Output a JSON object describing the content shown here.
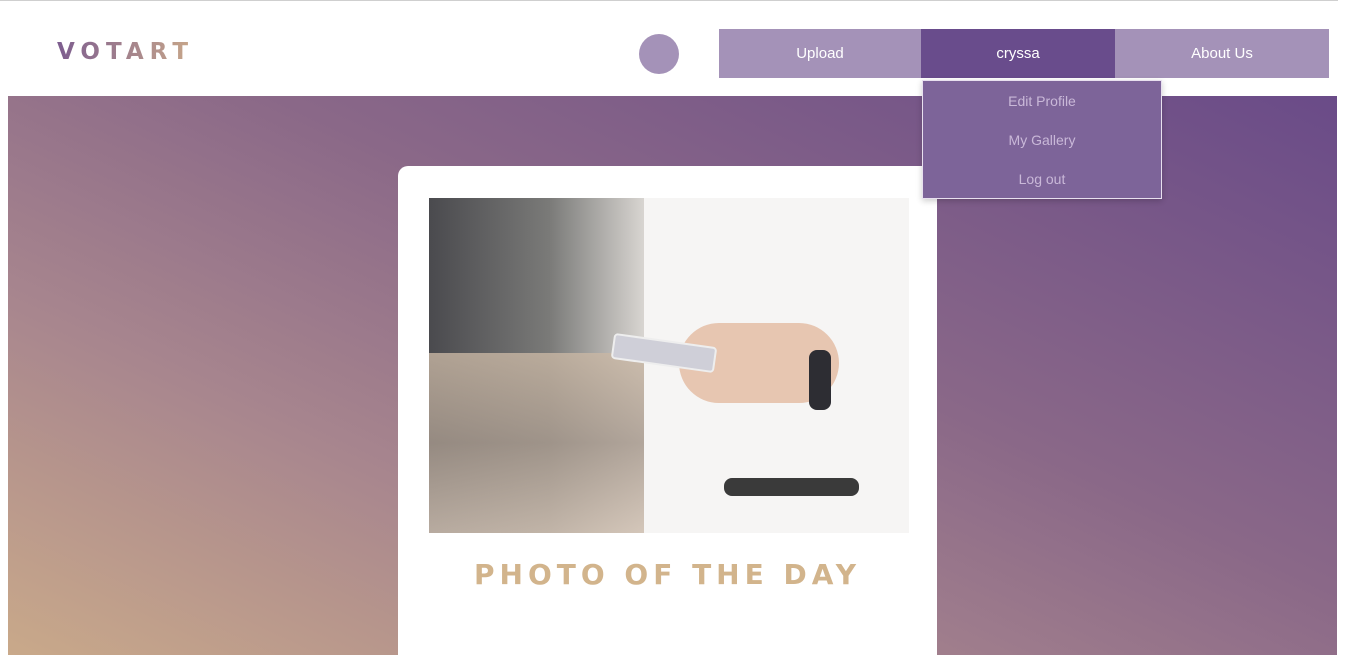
{
  "header": {
    "logo": "VOTART",
    "nav": {
      "upload": "Upload",
      "user": "cryssa",
      "about": "About Us"
    }
  },
  "user_menu": {
    "items": [
      "Edit Profile",
      "My Gallery",
      "Log out"
    ]
  },
  "card": {
    "title": "PHOTO OF THE DAY"
  },
  "colors": {
    "nav": "#a492b8",
    "nav_active": "#694c8c",
    "dropdown": "#7d6499",
    "title": "#d2b48c"
  }
}
